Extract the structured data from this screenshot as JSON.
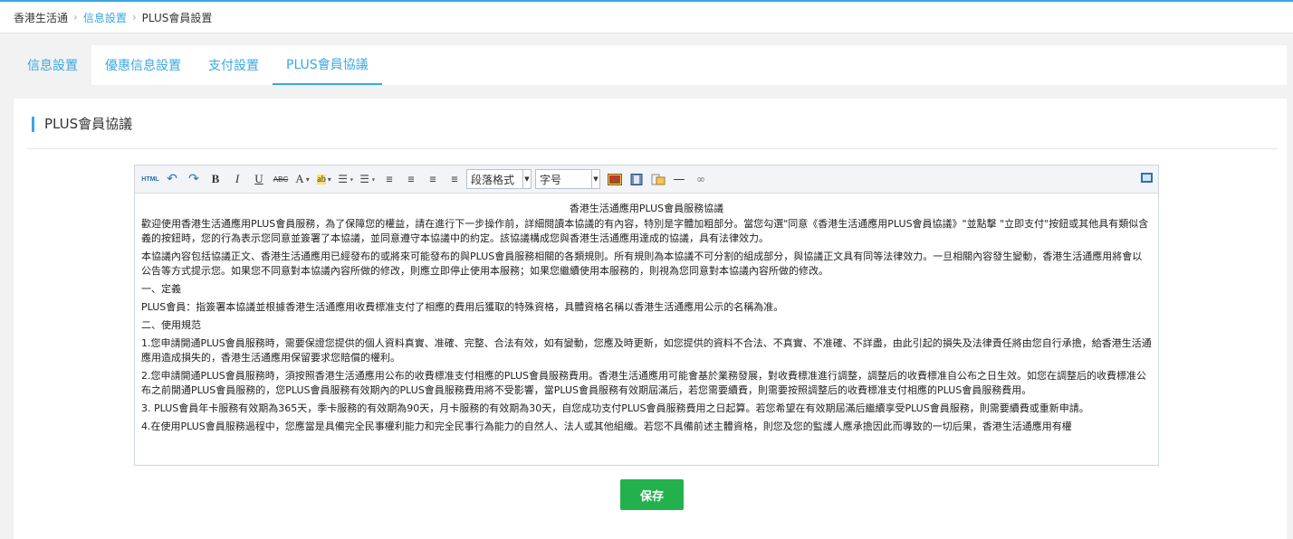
{
  "breadcrumb": {
    "items": [
      "香港生活通",
      "信息設置",
      "PLUS會員設置"
    ],
    "separator": ">"
  },
  "tabs": [
    {
      "label": "信息設置"
    },
    {
      "label": "優惠信息設置"
    },
    {
      "label": "支付設置"
    },
    {
      "label": "PLUS會員協議"
    }
  ],
  "panel": {
    "title": "PLUS會員協議"
  },
  "toolbar": {
    "html_label": "HTML",
    "paragraph_format": "段落格式",
    "font_size": "字号"
  },
  "content": {
    "title": "香港生活通應用PLUS會員服務協議",
    "paragraphs": [
      "歡迎使用香港生活通應用PLUS會員服務，為了保障您的權益，請在進行下一步操作前，詳細閱讀本協議的有內容，特別是字體加粗部分。當您勾選\"同意《香港生活通應用PLUS會員協議》\"並點擊 \"立即支付\"按鈕或其他具有類似含義的按鈕時，您的行為表示您同意並簽署了本協議，並同意遵守本協議中的約定。該協議構成您與香港生活通應用達成的協議，具有法律效力。",
      "本協議內容包括協議正文、香港生活通應用已經發布的或將來可能發布的與PLUS會員服務相關的各類規則。所有規則為本協議不可分割的組成部分，與協議正文具有同等法律效力。一旦相關內容發生變動，香港生活通應用將會以公告等方式提示您。如果您不同意對本協議內容所做的修改，則應立即停止使用本服務；如果您繼續使用本服務的，則視為您同意對本協議內容所做的修改。",
      "一、定義",
      "PLUS會員：指簽署本協議並根據香港生活通應用收費標准支付了相應的費用后獲取的特殊資格，具體資格名稱以香港生活通應用公示的名稱為准。",
      " 二、使用規范",
      "1.您申請開通PLUS會員服務時，需要保證您提供的個人資料真實、准確、完整、合法有效，如有變動，您應及時更新，如您提供的資料不合法、不真實、不准確、不詳盡，由此引起的損失及法律責任將由您自行承擔，給香港生活通應用造成損失的，香港生活通應用保留要求您賠償的權利。",
      "2.您申請開通PLUS會員服務時，須按照香港生活通應用公布的收費標准支付相應的PLUS會員服務費用。香港生活通應用可能會基於業務發展，對收費標准進行調整，調整后的收費標准自公布之日生效。如您在調整后的收費標准公布之前開通PLUS會員服務的，您PLUS會員服務有效期內的PLUS會員服務費用將不受影響，當PLUS會員服務有效期屆滿后，若您需要續費，則需要按照調整后的收費標准支付相應的PLUS會員服務費用。",
      "3. PLUS會員年卡服務有效期為365天，季卡服務的有效期為90天，月卡服務的有效期為30天，自您成功支付PLUS會員服務費用之日起算。若您希望在有效期屆滿后繼續享受PLUS會員服務，則需要續費或重新申請。",
      "4.在使用PLUS會員服務過程中，您應當是具備完全民事權利能力和完全民事行為能力的自然人、法人或其他組織。若您不具備前述主體資格，則您及您的監護人應承擔因此而導致的一切后果，香港生活通應用有權"
    ]
  },
  "save_button": {
    "label": "保存",
    "color": "#23b14d"
  },
  "colors": {
    "accent": "#3aa8e0"
  }
}
